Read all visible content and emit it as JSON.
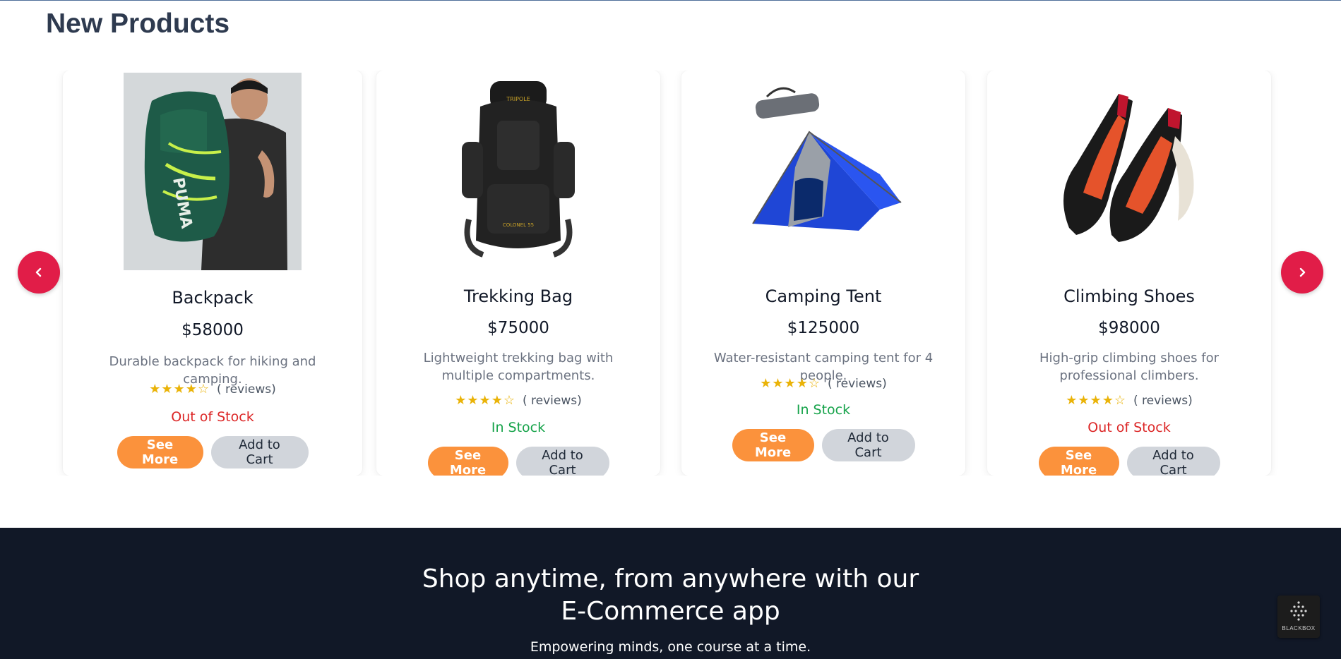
{
  "section": {
    "title": "New Products"
  },
  "carousel": {
    "prev_icon": "chevron-left-icon",
    "next_icon": "chevron-right-icon",
    "accent_color": "#e11d48",
    "products": [
      {
        "name": "Backpack",
        "price": "$58000",
        "description": "Durable backpack for hiking and camping.",
        "rating": 4,
        "stars": "★★★★☆",
        "reviews": "( reviews)",
        "stock": "Out of Stock",
        "in_stock": false,
        "see_more": "See More",
        "add_to_cart": "Add to Cart",
        "image": "backpack-image"
      },
      {
        "name": "Trekking Bag",
        "price": "$75000",
        "description": "Lightweight trekking bag with multiple compartments.",
        "rating": 4,
        "stars": "★★★★☆",
        "reviews": "( reviews)",
        "stock": "In Stock",
        "in_stock": true,
        "see_more": "See More",
        "add_to_cart": "Add to Cart",
        "image": "trekking-bag-image"
      },
      {
        "name": "Camping Tent",
        "price": "$125000",
        "description": "Water-resistant camping tent for 4 people.",
        "rating": 4,
        "stars": "★★★★☆",
        "reviews": "( reviews)",
        "stock": "In Stock",
        "in_stock": true,
        "see_more": "See More",
        "add_to_cart": "Add to Cart",
        "image": "camping-tent-image"
      },
      {
        "name": "Climbing Shoes",
        "price": "$98000",
        "description": "High-grip climbing shoes for professional climbers.",
        "rating": 4,
        "stars": "★★★★☆",
        "reviews": "( reviews)",
        "stock": "Out of Stock",
        "in_stock": false,
        "see_more": "See More",
        "add_to_cart": "Add to Cart",
        "image": "climbing-shoes-image"
      }
    ]
  },
  "footer": {
    "heading_line1": "Shop anytime, from anywhere with our",
    "heading_line2": "E-Commerce app",
    "subtitle": "Empowering minds, one course at a time.",
    "watermark": "BLACKBOX"
  },
  "colors": {
    "see_more": "#fb923c",
    "add_to_cart": "#d1d5db",
    "out_of_stock": "#dc2626",
    "in_stock": "#16a34a",
    "stars": "#eab308",
    "footer_bg": "#111827"
  }
}
